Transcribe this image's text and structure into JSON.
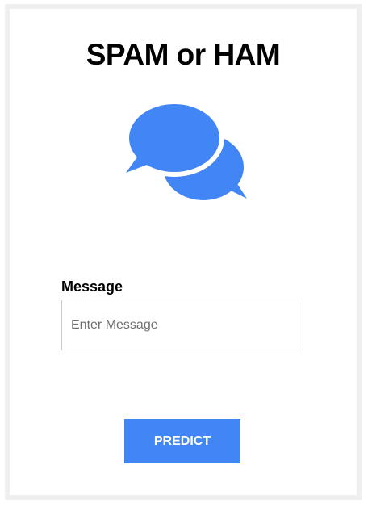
{
  "page": {
    "title": "SPAM or HAM"
  },
  "logo": {
    "icon": "chat-bubbles-icon",
    "color": "#4285f4"
  },
  "form": {
    "message_label": "Message",
    "message_placeholder": "Enter Message",
    "message_value": "",
    "submit_label": "PREDICT"
  },
  "colors": {
    "accent": "#4285f4",
    "frame": "#efefef"
  }
}
